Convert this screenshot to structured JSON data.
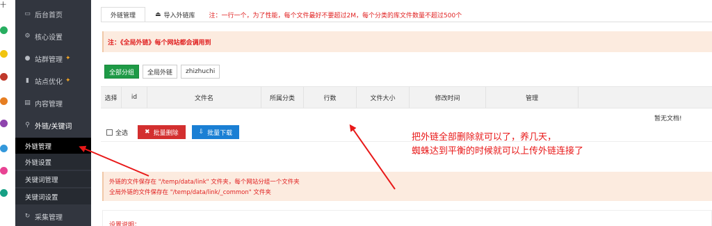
{
  "strip": {
    "top_glyph": "十",
    "dots": [
      "#f39c12",
      "#2ecc71",
      "#f1c40f",
      "#e74c3c",
      "#9b59b6",
      "#3498db",
      "#e67e22",
      "#1abc9c",
      "#e84393",
      "#00b894"
    ]
  },
  "sidebar": {
    "items": [
      {
        "label": "后台首页",
        "icon": "monitor-icon"
      },
      {
        "label": "核心设置",
        "icon": "gear-icon"
      },
      {
        "label": "站群管理",
        "icon": "user-icon",
        "pin": true
      },
      {
        "label": "站点优化",
        "icon": "chart-icon",
        "pin": true
      },
      {
        "label": "内容管理",
        "icon": "document-icon"
      },
      {
        "label": "外链/关键词",
        "icon": "link-icon"
      }
    ],
    "subitems": [
      {
        "label": "外链管理",
        "active": true
      },
      {
        "label": "外链设置"
      },
      {
        "label": "关键词管理"
      },
      {
        "label": "关键词设置"
      }
    ],
    "bottom": {
      "label": "采集管理",
      "icon": "refresh-icon"
    }
  },
  "tabs": [
    {
      "label": "外链管理",
      "active": true
    },
    {
      "label": "导入外链库",
      "icon": "import-icon"
    }
  ],
  "tab_note": "注：一行一个，为了性能，每个文件最好不要超过2M，每个分类的库文件数量不超过500个",
  "notice1": "注：《全局外链》每个网站都会调用到",
  "groups": [
    "全部分组",
    "全局外链",
    "zhizhuchi"
  ],
  "table": {
    "headers": [
      "选择",
      "id",
      "文件名",
      "所属分类",
      "行数",
      "文件大小",
      "修改时间",
      "管理"
    ],
    "empty": "暂无文档!"
  },
  "actions": {
    "select_all": "全选",
    "delete": "批量删除",
    "download": "批量下载"
  },
  "notice2": {
    "line1": "外链的文件保存在 \"/temp/data/link\" 文件夹，每个网站分组一个文件夹",
    "line2": "全局外链的文件保存在 \"/temp/data/link/_common\" 文件夹"
  },
  "settings_title": "设置说明：",
  "annotation": {
    "line1": "把外链全部删除就可以了，养几天，",
    "line2": "蜘蛛达到平衡的时候就可以上传外链连接了"
  },
  "colors": {
    "sidebar": "#32363f",
    "accent_green": "#1e9a46",
    "danger_red": "#d32f2f",
    "primary_blue": "#1a7fd4",
    "notice_bg": "#fcebdf",
    "annotation_red": "#e81818"
  }
}
